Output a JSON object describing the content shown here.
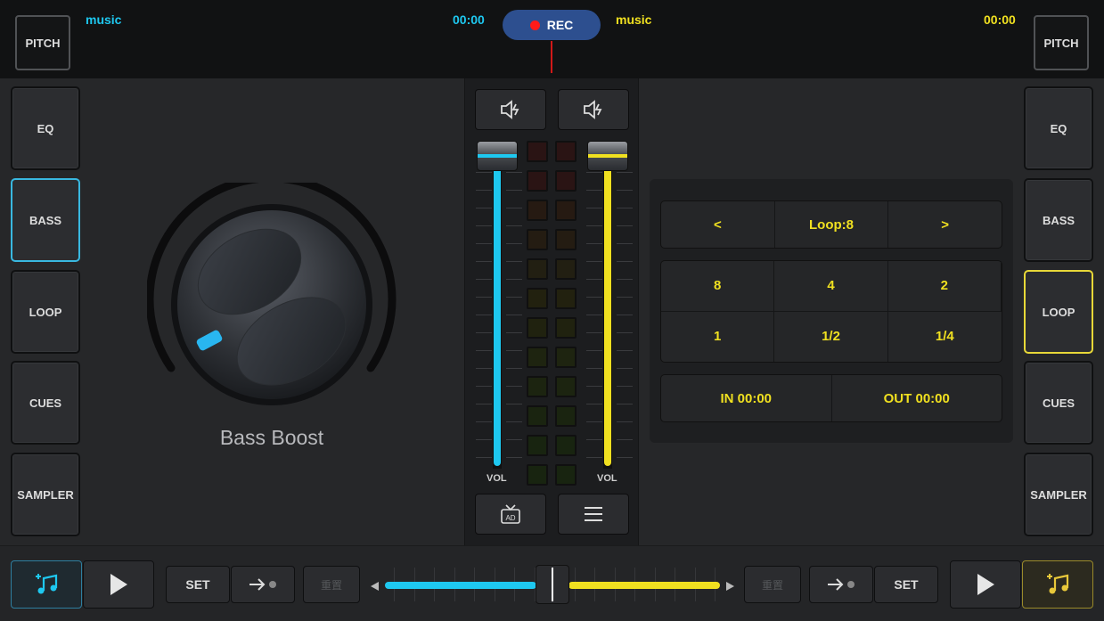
{
  "top": {
    "left_pitch": "PITCH",
    "right_pitch": "PITCH",
    "deck_a": {
      "track": "music",
      "time": "00:00"
    },
    "deck_b": {
      "track": "music",
      "time": "00:00"
    },
    "rec_label": "REC"
  },
  "left_tabs": [
    "EQ",
    "BASS",
    "LOOP",
    "CUES",
    "SAMPLER"
  ],
  "right_tabs": [
    "EQ",
    "BASS",
    "LOOP",
    "CUES",
    "SAMPLER"
  ],
  "left_active": "BASS",
  "right_active": "LOOP",
  "knob": {
    "label": "Bass Boost",
    "icon": "knob-icon"
  },
  "mixer": {
    "vol_left": "VOL",
    "vol_right": "VOL",
    "left_volume_level": 1.0,
    "right_volume_level": 1.0,
    "ad_icon_text": "AD"
  },
  "loop": {
    "prev": "<",
    "title": "Loop:8",
    "next": ">",
    "sizes": [
      "8",
      "4",
      "2",
      "1",
      "1/2",
      "1/4"
    ],
    "in_label": "IN 00:00",
    "out_label": "OUT 00:00"
  },
  "bottom": {
    "set_left": "SET",
    "set_right": "SET",
    "reset_left": "重置",
    "reset_right": "重置",
    "crossfader_position": 0.5
  },
  "colors": {
    "deck_a": "#1ec8f0",
    "deck_b": "#f0e020",
    "rec": "#2d4f8f"
  }
}
